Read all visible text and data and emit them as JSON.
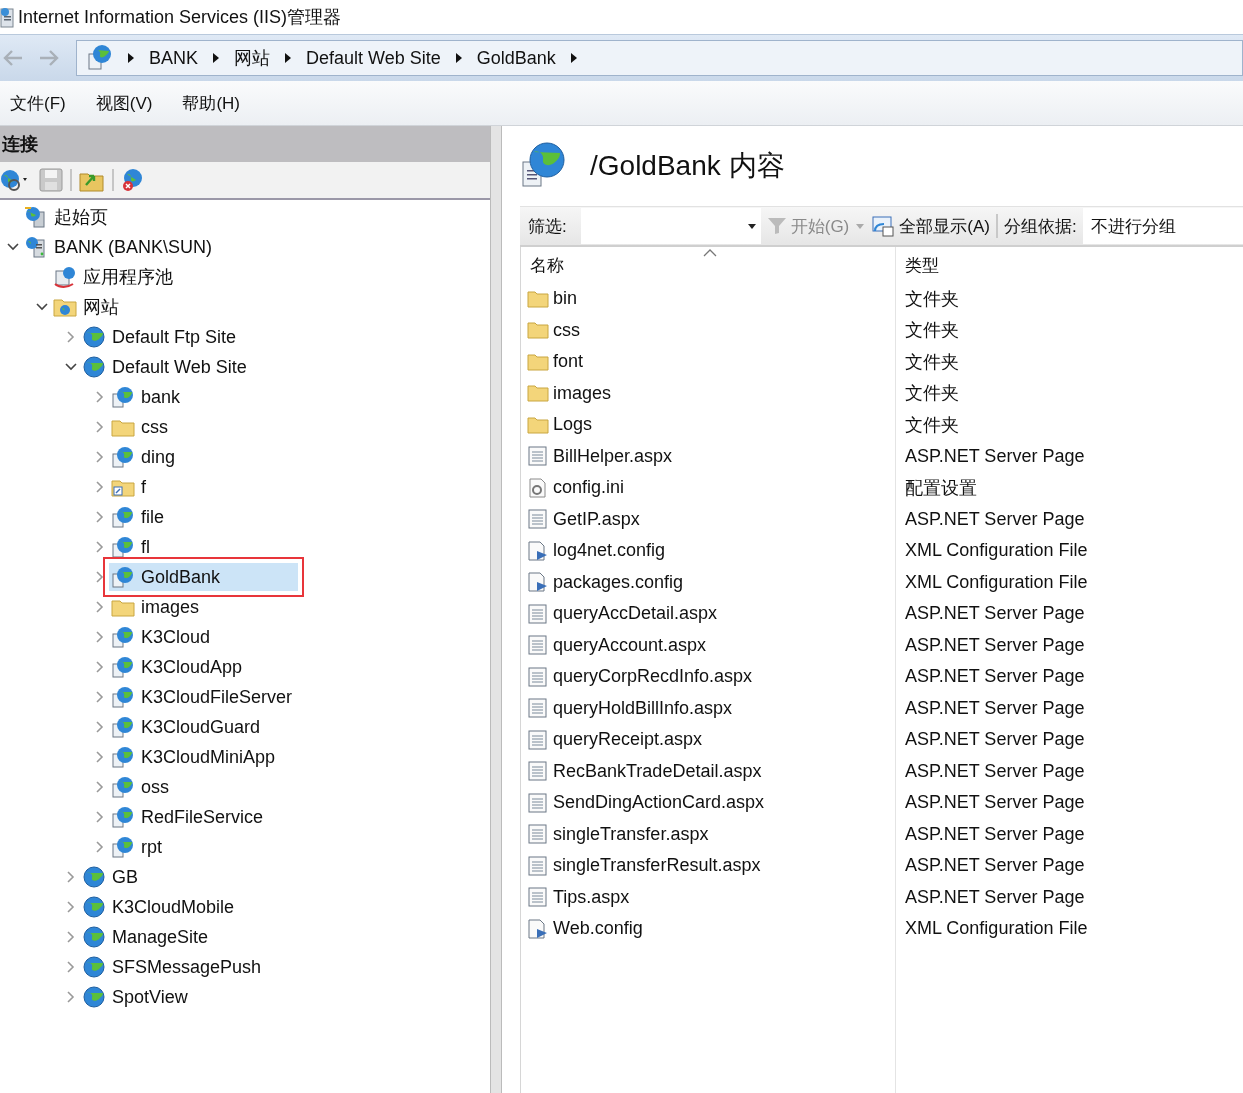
{
  "window": {
    "title": "Internet Information Services (IIS)管理器"
  },
  "nav_buttons": [
    {
      "kind": "back",
      "disabled": true
    },
    {
      "kind": "forward",
      "disabled": true
    }
  ],
  "breadcrumb": [
    "BANK",
    "网站",
    "Default Web Site",
    "GoldBank"
  ],
  "menu": [
    "文件(F)",
    "视图(V)",
    "帮助(H)"
  ],
  "connections": {
    "title": "连接",
    "toolbar": [
      {
        "kind": "connect",
        "disabled": false
      },
      {
        "kind": "save",
        "disabled": true
      },
      {
        "kind": "up",
        "disabled": false
      },
      {
        "kind": "disconnect",
        "disabled": false
      }
    ],
    "tree": [
      {
        "label": "起始页",
        "kind": "start",
        "selected": false,
        "highlighted": false
      },
      {
        "label": "BANK (BANK\\SUN)",
        "kind": "server",
        "expanded": true,
        "leaf": false,
        "selected": false,
        "highlighted": false,
        "children": [
          {
            "label": "应用程序池",
            "kind": "pool",
            "selected": false,
            "highlighted": false
          },
          {
            "label": "网站",
            "kind": "sites",
            "expanded": true,
            "leaf": false,
            "selected": false,
            "highlighted": false,
            "children": [
              {
                "label": "Default Ftp Site",
                "kind": "site",
                "expanded": false,
                "leaf": false,
                "selected": false,
                "highlighted": false
              },
              {
                "label": "Default Web Site",
                "kind": "site",
                "expanded": true,
                "leaf": false,
                "selected": false,
                "highlighted": false,
                "children": [
                  {
                    "label": "bank",
                    "kind": "app",
                    "expanded": false,
                    "leaf": false,
                    "selected": false,
                    "highlighted": false
                  },
                  {
                    "label": "css",
                    "kind": "folder",
                    "expanded": false,
                    "leaf": false,
                    "selected": false,
                    "highlighted": false
                  },
                  {
                    "label": "ding",
                    "kind": "app",
                    "expanded": false,
                    "leaf": false,
                    "selected": false,
                    "highlighted": false
                  },
                  {
                    "label": "f",
                    "kind": "vdir",
                    "expanded": false,
                    "leaf": false,
                    "selected": false,
                    "highlighted": false
                  },
                  {
                    "label": "file",
                    "kind": "app",
                    "expanded": false,
                    "leaf": false,
                    "selected": false,
                    "highlighted": false
                  },
                  {
                    "label": "fl",
                    "kind": "app",
                    "expanded": false,
                    "leaf": false,
                    "selected": false,
                    "highlighted": false
                  },
                  {
                    "label": "GoldBank",
                    "kind": "app",
                    "expanded": false,
                    "leaf": false,
                    "selected": true,
                    "highlighted": true
                  },
                  {
                    "label": "images",
                    "kind": "folder",
                    "expanded": false,
                    "leaf": false,
                    "selected": false,
                    "highlighted": false
                  },
                  {
                    "label": "K3Cloud",
                    "kind": "app",
                    "expanded": false,
                    "leaf": false,
                    "selected": false,
                    "highlighted": false
                  },
                  {
                    "label": "K3CloudApp",
                    "kind": "app",
                    "expanded": false,
                    "leaf": false,
                    "selected": false,
                    "highlighted": false
                  },
                  {
                    "label": "K3CloudFileServer",
                    "kind": "app",
                    "expanded": false,
                    "leaf": false,
                    "selected": false,
                    "highlighted": false
                  },
                  {
                    "label": "K3CloudGuard",
                    "kind": "app",
                    "expanded": false,
                    "leaf": false,
                    "selected": false,
                    "highlighted": false
                  },
                  {
                    "label": "K3CloudMiniApp",
                    "kind": "app",
                    "expanded": false,
                    "leaf": false,
                    "selected": false,
                    "highlighted": false
                  },
                  {
                    "label": "oss",
                    "kind": "app",
                    "expanded": false,
                    "leaf": false,
                    "selected": false,
                    "highlighted": false
                  },
                  {
                    "label": "RedFileService",
                    "kind": "app",
                    "expanded": false,
                    "leaf": false,
                    "selected": false,
                    "highlighted": false
                  },
                  {
                    "label": "rpt",
                    "kind": "app",
                    "expanded": false,
                    "leaf": false,
                    "selected": false,
                    "highlighted": false
                  }
                ]
              },
              {
                "label": "GB",
                "kind": "site",
                "expanded": false,
                "leaf": false,
                "selected": false,
                "highlighted": false
              },
              {
                "label": "K3CloudMobile",
                "kind": "site",
                "expanded": false,
                "leaf": false,
                "selected": false,
                "highlighted": false
              },
              {
                "label": "ManageSite",
                "kind": "site",
                "expanded": false,
                "leaf": false,
                "selected": false,
                "highlighted": false
              },
              {
                "label": "SFSMessagePush",
                "kind": "site",
                "expanded": false,
                "leaf": false,
                "selected": false,
                "highlighted": false
              },
              {
                "label": "SpotView",
                "kind": "site",
                "expanded": false,
                "leaf": false,
                "selected": false,
                "highlighted": false
              }
            ]
          }
        ]
      }
    ]
  },
  "content": {
    "title": "/GoldBank 内容",
    "filter": {
      "label": "筛选:",
      "start": "开始(G)",
      "start_disabled": true,
      "show_all": "全部显示(A)",
      "group_label": "分组依据:",
      "group_value": "不进行分组"
    },
    "columns": [
      "名称",
      "类型"
    ],
    "files": [
      {
        "name": "bin",
        "kind": "folder",
        "type": "文件夹"
      },
      {
        "name": "css",
        "kind": "folder",
        "type": "文件夹"
      },
      {
        "name": "font",
        "kind": "folder",
        "type": "文件夹"
      },
      {
        "name": "images",
        "kind": "folder",
        "type": "文件夹"
      },
      {
        "name": "Logs",
        "kind": "folder",
        "type": "文件夹"
      },
      {
        "name": "BillHelper.aspx",
        "kind": "page",
        "type": "ASP.NET Server Page"
      },
      {
        "name": "config.ini",
        "kind": "settings",
        "type": "配置设置"
      },
      {
        "name": "GetIP.aspx",
        "kind": "page",
        "type": "ASP.NET Server Page"
      },
      {
        "name": "log4net.config",
        "kind": "xml",
        "type": "XML Configuration File"
      },
      {
        "name": "packages.config",
        "kind": "xml",
        "type": "XML Configuration File"
      },
      {
        "name": "queryAccDetail.aspx",
        "kind": "page",
        "type": "ASP.NET Server Page"
      },
      {
        "name": "queryAccount.aspx",
        "kind": "page",
        "type": "ASP.NET Server Page"
      },
      {
        "name": "queryCorpRecdInfo.aspx",
        "kind": "page",
        "type": "ASP.NET Server Page"
      },
      {
        "name": "queryHoldBillInfo.aspx",
        "kind": "page",
        "type": "ASP.NET Server Page"
      },
      {
        "name": "queryReceipt.aspx",
        "kind": "page",
        "type": "ASP.NET Server Page"
      },
      {
        "name": "RecBankTradeDetail.aspx",
        "kind": "page",
        "type": "ASP.NET Server Page"
      },
      {
        "name": "SendDingActionCard.aspx",
        "kind": "page",
        "type": "ASP.NET Server Page"
      },
      {
        "name": "singleTransfer.aspx",
        "kind": "page",
        "type": "ASP.NET Server Page"
      },
      {
        "name": "singleTransferResult.aspx",
        "kind": "page",
        "type": "ASP.NET Server Page"
      },
      {
        "name": "Tips.aspx",
        "kind": "page",
        "type": "ASP.NET Server Page"
      },
      {
        "name": "Web.config",
        "kind": "xml",
        "type": "XML Configuration File"
      }
    ]
  }
}
